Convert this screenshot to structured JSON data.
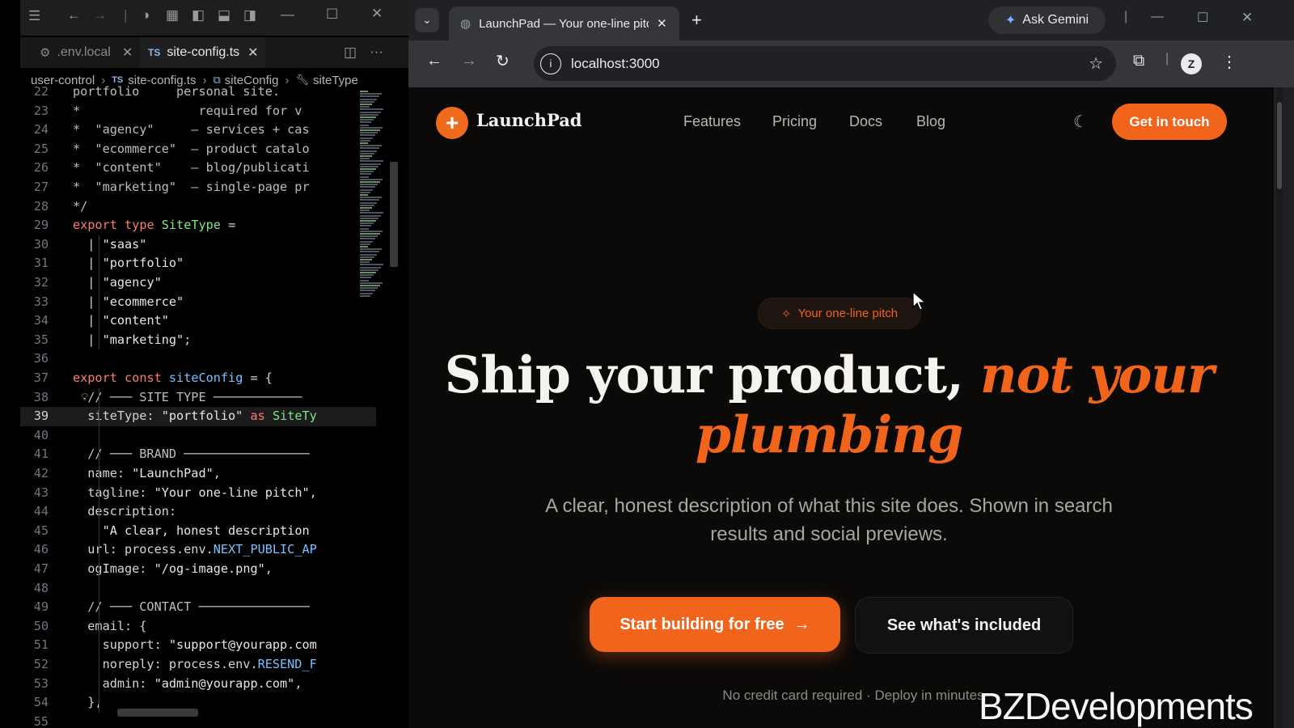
{
  "editor": {
    "tabs": [
      {
        "label": ".env.local",
        "icon": "gear-icon"
      },
      {
        "label": "site-config.ts",
        "icon": "ts-icon",
        "prefix": "TS"
      }
    ],
    "breadcrumb": [
      "user-control",
      "site-config.ts",
      "siteConfig",
      "siteType"
    ],
    "lines": [
      {
        "n": "22",
        "text": "portfolio     personal site."
      },
      {
        "n": "23",
        "text": "*                required for v"
      },
      {
        "n": "24",
        "text": "*  \"agency\"     — services + cas"
      },
      {
        "n": "25",
        "text": "*  \"ecommerce\"  — product catalo"
      },
      {
        "n": "26",
        "text": "*  \"content\"    — blog/publicati"
      },
      {
        "n": "27",
        "text": "*  \"marketing\"  — single-page pr"
      },
      {
        "n": "28",
        "text": "*/"
      },
      {
        "n": "29",
        "text": "export type SiteType ="
      },
      {
        "n": "30",
        "text": "  | \"saas\""
      },
      {
        "n": "31",
        "text": "  | \"portfolio\""
      },
      {
        "n": "32",
        "text": "  | \"agency\""
      },
      {
        "n": "33",
        "text": "  | \"ecommerce\""
      },
      {
        "n": "34",
        "text": "  | \"content\""
      },
      {
        "n": "35",
        "text": "  | \"marketing\";"
      },
      {
        "n": "36",
        "text": ""
      },
      {
        "n": "37",
        "text": "export const siteConfig = {"
      },
      {
        "n": "38",
        "text": "  // ─── SITE TYPE ────────────"
      },
      {
        "n": "39",
        "text": "  siteType: \"portfolio\" as SiteTy"
      },
      {
        "n": "40",
        "text": ""
      },
      {
        "n": "41",
        "text": "  // ─── BRAND ─────────────────"
      },
      {
        "n": "42",
        "text": "  name: \"LaunchPad\","
      },
      {
        "n": "43",
        "text": "  tagline: \"Your one-line pitch\","
      },
      {
        "n": "44",
        "text": "  description:"
      },
      {
        "n": "45",
        "text": "    \"A clear, honest description"
      },
      {
        "n": "46",
        "text": "  url: process.env.NEXT_PUBLIC_AP"
      },
      {
        "n": "47",
        "text": "  ogImage: \"/og-image.png\","
      },
      {
        "n": "48",
        "text": ""
      },
      {
        "n": "49",
        "text": "  // ─── CONTACT ───────────────"
      },
      {
        "n": "50",
        "text": "  email: {"
      },
      {
        "n": "51",
        "text": "    support: \"support@yourapp.com"
      },
      {
        "n": "52",
        "text": "    noreply: process.env.RESEND_F"
      },
      {
        "n": "53",
        "text": "    admin: \"admin@yourapp.com\","
      },
      {
        "n": "54",
        "text": "  },"
      },
      {
        "n": "55",
        "text": ""
      }
    ]
  },
  "browser": {
    "tab_title": "LaunchPad — Your one-line pitc",
    "ask_gemini": "Ask Gemini",
    "url": "localhost:3000",
    "profile_initial": "Z"
  },
  "site": {
    "brand": "LaunchPad",
    "nav": [
      "Features",
      "Pricing",
      "Docs",
      "Blog"
    ],
    "cta": "Get in touch",
    "pitch_badge": "Your one-line pitch",
    "headline_plain": "Ship your product, ",
    "headline_accent": "not your plumbing",
    "description": "A clear, honest description of what this site does. Shown in search results and social previews.",
    "primary_button": "Start building for free",
    "secondary_button": "See what's included",
    "footnote": "No credit card required · Deploy in minutes",
    "accent_color": "#f0641c"
  },
  "watermark": "BZDevelopments"
}
